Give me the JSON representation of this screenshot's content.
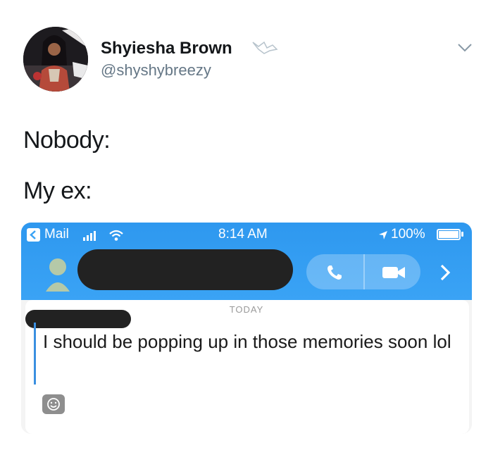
{
  "tweet": {
    "author_name": "Shyiesha Brown",
    "author_handle": "@shyshybreezy",
    "text_line1": "Nobody:",
    "text_line2": "My ex:"
  },
  "screenshot": {
    "status_bar": {
      "back_app": "Mail",
      "time": "8:14 AM",
      "battery": "100%"
    },
    "conversation": {
      "date_label": "TODAY",
      "message": "I should be popping up in those memories soon lol"
    }
  },
  "colors": {
    "header_blue": "#3aa3f5",
    "handle_gray": "#657786",
    "quote_bar": "#3a8fe0",
    "redaction": "#222222"
  },
  "icons": [
    "bird-icon",
    "chevron-down-icon",
    "signal-icon",
    "wifi-icon",
    "location-arrow-icon",
    "phone-icon",
    "video-icon",
    "chevron-right-icon",
    "smiley-icon"
  ]
}
